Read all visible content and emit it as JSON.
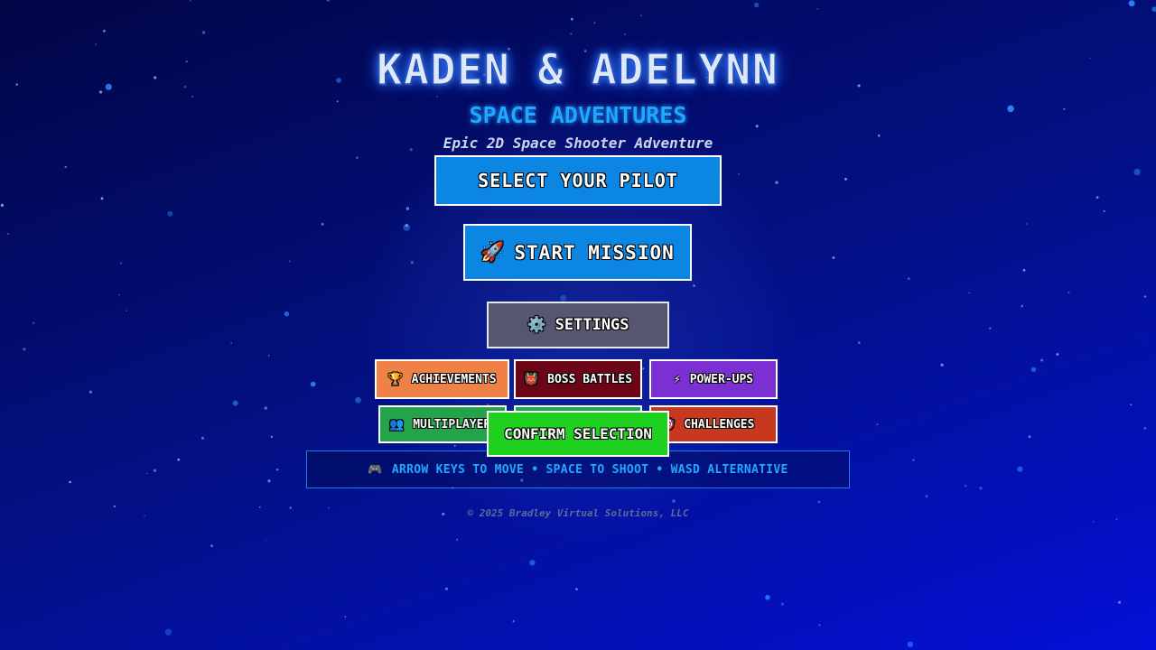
{
  "game": {
    "title": "KADEN & ADELYNN",
    "subtitle": "SPACE ADVENTURES",
    "tagline": "Epic 2D Space Shooter Adventure"
  },
  "menu": {
    "select_pilot": "SELECT YOUR PILOT",
    "start_mission": {
      "icon": "🚀",
      "label": "START MISSION"
    },
    "settings": {
      "icon": "⚙️",
      "label": "SETTINGS"
    },
    "achievements": {
      "icon": "🏆",
      "label": "ACHIEVEMENTS"
    },
    "boss_battles": {
      "icon": "👹",
      "label": "BOSS BATTLES"
    },
    "power_ups": {
      "icon": "⚡",
      "label": "POWER-UPS"
    },
    "multiplayer": {
      "icon": "👥",
      "label": "MULTIPLAYER"
    },
    "challenges": {
      "icon": "🎯",
      "label": "CHALLENGES"
    },
    "confirm": "CONFIRM SELECTION"
  },
  "controls": {
    "icon": "🎮",
    "text": "ARROW KEYS TO MOVE • SPACE TO SHOOT • WASD ALTERNATIVE"
  },
  "footer": {
    "copyright": "© 2025 Bradley Virtual Solutions, LLC"
  },
  "colors": {
    "primary_button": "#0b86e3",
    "settings_button": "#56576e",
    "achievements": "#ef8046",
    "boss_battles": "#6c0617",
    "power_ups": "#7c2fd2",
    "multiplayer": "#23a34a",
    "challenges": "#c8381f",
    "confirm": "#1fd11f",
    "accent_text": "#1fa8ff"
  }
}
